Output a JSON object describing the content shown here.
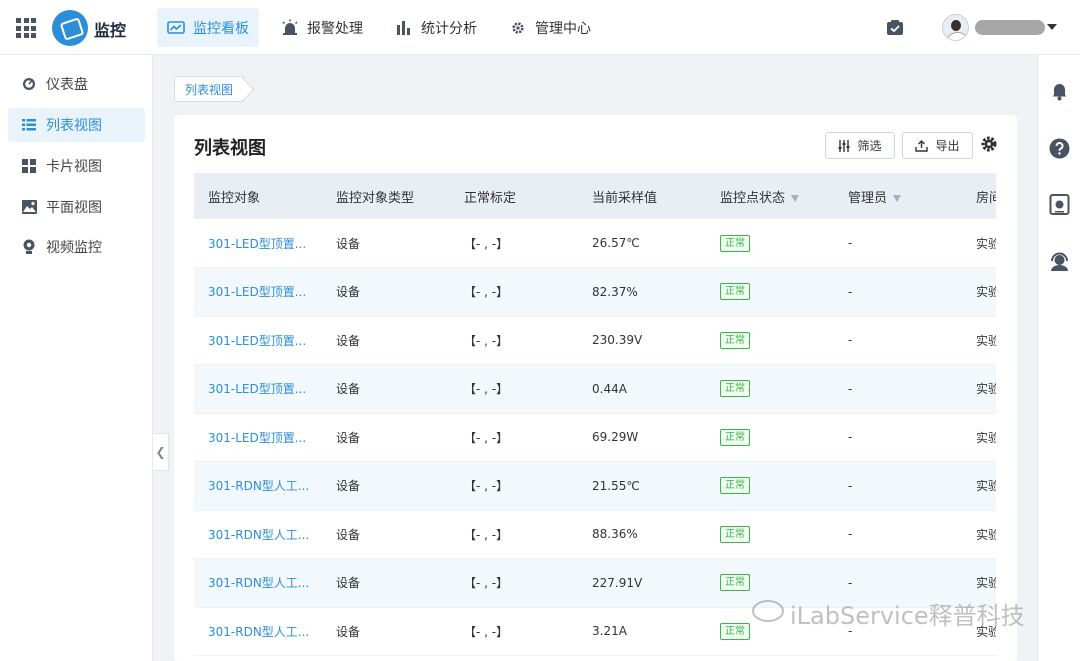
{
  "header": {
    "logo_text": "监控",
    "nav": [
      {
        "label": "监控看板",
        "icon": "monitor-board-icon",
        "active": true
      },
      {
        "label": "报警处理",
        "icon": "alarm-icon",
        "active": false
      },
      {
        "label": "统计分析",
        "icon": "stats-chart-icon",
        "active": false
      },
      {
        "label": "管理中心",
        "icon": "gear-icon",
        "active": false
      }
    ]
  },
  "sidebar": {
    "items": [
      {
        "label": "仪表盘",
        "icon": "dashboard-icon",
        "active": false
      },
      {
        "label": "列表视图",
        "icon": "list-icon",
        "active": true
      },
      {
        "label": "卡片视图",
        "icon": "card-grid-icon",
        "active": false
      },
      {
        "label": "平面视图",
        "icon": "map-icon",
        "active": false
      },
      {
        "label": "视频监控",
        "icon": "camera-icon",
        "active": false
      }
    ]
  },
  "breadcrumb": "列表视图",
  "card": {
    "title": "列表视图",
    "filter_label": "筛选",
    "export_label": "导出"
  },
  "table": {
    "headers": [
      "监控对象",
      "监控对象类型",
      "正常标定",
      "当前采样值",
      "监控点状态",
      "管理员",
      "房间"
    ],
    "rows": [
      {
        "object": "301-LED型顶置...",
        "type": "设备",
        "range": "【- , -】",
        "value": "26.57℃",
        "status": "正常",
        "admin": "-",
        "room": "实验"
      },
      {
        "object": "301-LED型顶置...",
        "type": "设备",
        "range": "【- , -】",
        "value": "82.37%",
        "status": "正常",
        "admin": "-",
        "room": "实验"
      },
      {
        "object": "301-LED型顶置...",
        "type": "设备",
        "range": "【- , -】",
        "value": "230.39V",
        "status": "正常",
        "admin": "-",
        "room": "实验"
      },
      {
        "object": "301-LED型顶置...",
        "type": "设备",
        "range": "【- , -】",
        "value": "0.44A",
        "status": "正常",
        "admin": "-",
        "room": "实验"
      },
      {
        "object": "301-LED型顶置...",
        "type": "设备",
        "range": "【- , -】",
        "value": "69.29W",
        "status": "正常",
        "admin": "-",
        "room": "实验"
      },
      {
        "object": "301-RDN型人工...",
        "type": "设备",
        "range": "【- , -】",
        "value": "21.55℃",
        "status": "正常",
        "admin": "-",
        "room": "实验"
      },
      {
        "object": "301-RDN型人工...",
        "type": "设备",
        "range": "【- , -】",
        "value": "88.36%",
        "status": "正常",
        "admin": "-",
        "room": "实验"
      },
      {
        "object": "301-RDN型人工...",
        "type": "设备",
        "range": "【- , -】",
        "value": "227.91V",
        "status": "正常",
        "admin": "-",
        "room": "实验"
      },
      {
        "object": "301-RDN型人工...",
        "type": "设备",
        "range": "【- , -】",
        "value": "3.21A",
        "status": "正常",
        "admin": "-",
        "room": "实验"
      }
    ]
  },
  "watermark": "iLabService释普科技",
  "colors": {
    "accent": "#2d8ed8",
    "status_ok": "#3bb54a",
    "header_bg": "#e9eef4"
  }
}
